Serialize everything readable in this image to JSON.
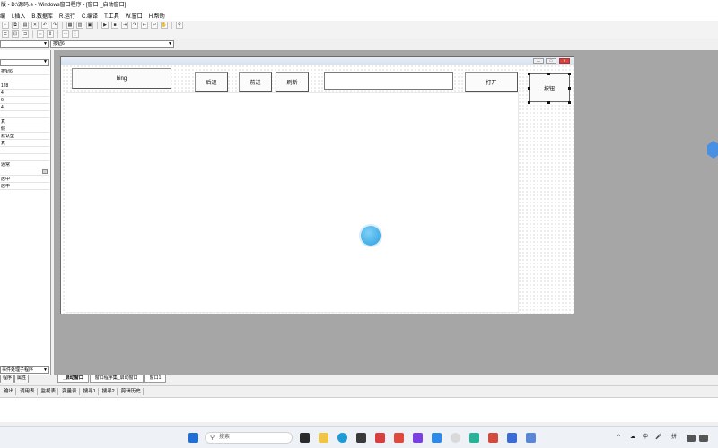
{
  "window": {
    "title": "版 - D:\\源码.e - Windows窗口程序 - [窗口 _启动窗口]"
  },
  "menu": [
    "编",
    "I.插入",
    "B.数据库",
    "R.运行",
    "C.编译",
    "T.工具",
    "W.窗口",
    "H.帮助"
  ],
  "combos": {
    "left": "",
    "right": "按钮6"
  },
  "left_panel": {
    "selector": "",
    "rows": [
      "按钮6",
      "",
      "128",
      "4",
      "6",
      "4",
      "",
      "",
      "真",
      "假",
      "默认型",
      "真",
      "",
      "",
      "通常",
      "",
      "居中",
      "居中"
    ],
    "event_combo": "事件处理子程序",
    "tabs": [
      "程序",
      "属性"
    ]
  },
  "form": {
    "buttons": {
      "b1": "bing",
      "b2": "后退",
      "b3": "前进",
      "b4": "刷新",
      "b5": "打开"
    },
    "url_value": "",
    "selected_button": "按钮",
    "window_buttons": [
      "—",
      "□",
      "✕"
    ]
  },
  "doc_tabs": [
    "_启动窗口",
    "窗口程序集_启动窗口",
    "窗口1"
  ],
  "output_tabs": [
    "输出",
    "调用表",
    "监视表",
    "变量表",
    "搜寻1",
    "搜寻2",
    "剪辑历史"
  ],
  "taskbar": {
    "search_placeholder": "搜索",
    "tray": [
      "^",
      "☁",
      "中",
      "🎤",
      "拼"
    ]
  }
}
